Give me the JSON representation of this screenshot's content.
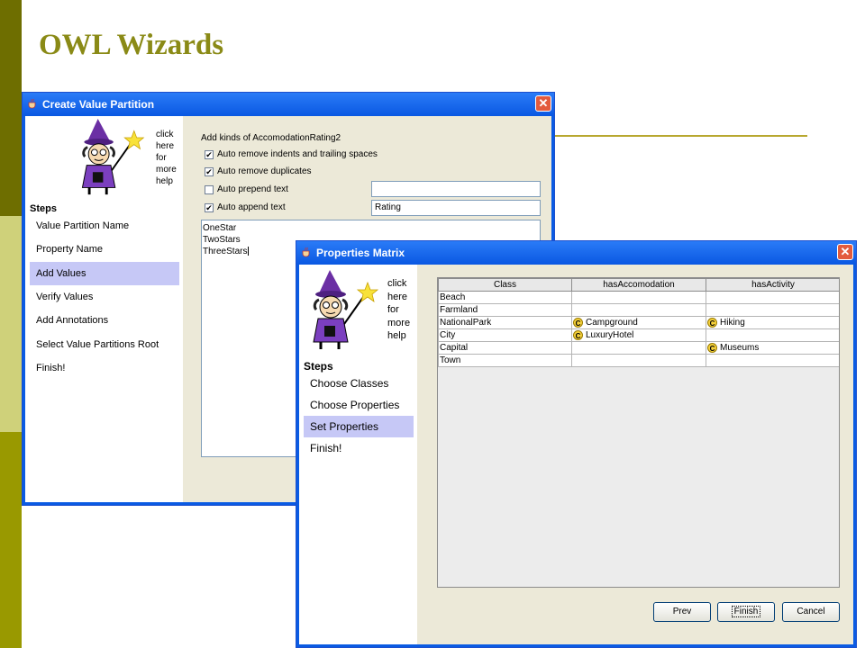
{
  "slide": {
    "title": "OWL Wizards"
  },
  "colors": {
    "titlebar": "#0a58e2",
    "active_step": "#c6c8f6",
    "slide_title": "#8a8a16",
    "close": "#e35b3d"
  },
  "win1": {
    "title": "Create Value Partition",
    "close_label": "✕",
    "help_lines": [
      "click",
      "here",
      "for",
      "more",
      "help"
    ],
    "steps_label": "Steps",
    "steps": [
      "Value Partition Name",
      "Property Name",
      "Add Values",
      "Verify Values",
      "Add Annotations",
      "Select Value Partitions Root",
      "Finish!"
    ],
    "active_step": "Add Values",
    "heading": "Add kinds of AccomodationRating2",
    "check_mark": "✔",
    "options": [
      {
        "label": "Auto remove indents and trailing spaces",
        "checked": true
      },
      {
        "label": "Auto remove duplicates",
        "checked": true
      },
      {
        "label": "Auto prepend text",
        "checked": false
      },
      {
        "label": "Auto append text",
        "checked": true
      }
    ],
    "prepend_value": "",
    "append_value": "Rating",
    "values": [
      "OneStar",
      "TwoStars",
      "ThreeStars"
    ]
  },
  "win2": {
    "title": "Properties Matrix",
    "close_label": "✕",
    "help_lines": [
      "click",
      "here",
      "for",
      "more",
      "help"
    ],
    "steps_label": "Steps",
    "steps": [
      "Choose Classes",
      "Choose Properties",
      "Set Properties",
      "Finish!"
    ],
    "active_step": "Set Properties",
    "columns": [
      "Class",
      "hasAccomodation",
      "hasActivity"
    ],
    "icon_letter": "C",
    "rows": [
      {
        "class": "Beach",
        "hasAccomodation": "",
        "hasActivity": ""
      },
      {
        "class": "Farmland",
        "hasAccomodation": "",
        "hasActivity": ""
      },
      {
        "class": "NationalPark",
        "hasAccomodation": "Campground",
        "hasActivity": "Hiking"
      },
      {
        "class": "City",
        "hasAccomodation": "LuxuryHotel",
        "hasActivity": ""
      },
      {
        "class": "Capital",
        "hasAccomodation": "",
        "hasActivity": "Museums"
      },
      {
        "class": "Town",
        "hasAccomodation": "",
        "hasActivity": ""
      }
    ],
    "buttons": {
      "prev": "Prev",
      "finish": "Finish",
      "cancel": "Cancel"
    }
  }
}
